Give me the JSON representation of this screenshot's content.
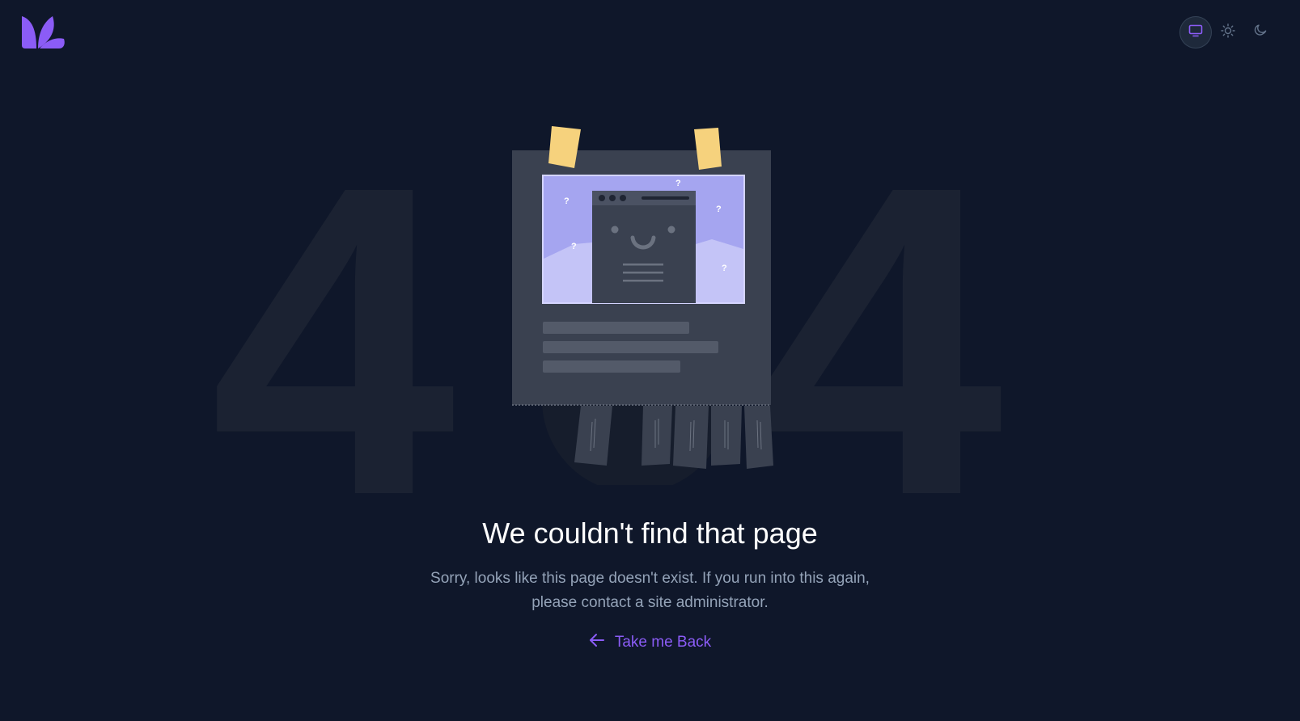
{
  "header": {
    "logo_icon": "leaf-logo-icon",
    "theme_options": [
      {
        "name": "system",
        "icon": "monitor-icon",
        "active": true
      },
      {
        "name": "light",
        "icon": "sun-icon",
        "active": false
      },
      {
        "name": "dark",
        "icon": "moon-icon",
        "active": false
      }
    ]
  },
  "background": {
    "digit_left": "4",
    "digit_right": "4"
  },
  "error": {
    "title": "We couldn't find that page",
    "subtitle": "Sorry, looks like this page doesn't exist. If you run into this again, please contact a site administrator.",
    "back_label": "Take me Back",
    "back_icon": "arrow-left-icon"
  },
  "colors": {
    "background": "#0f172a",
    "accent": "#8b5cf6",
    "title": "#ffffff",
    "subtitle": "#94a3b8",
    "digit": "#1b2232",
    "tape": "#f6d27d",
    "paper": "#3a4150",
    "screen": "#a5a5f0"
  }
}
